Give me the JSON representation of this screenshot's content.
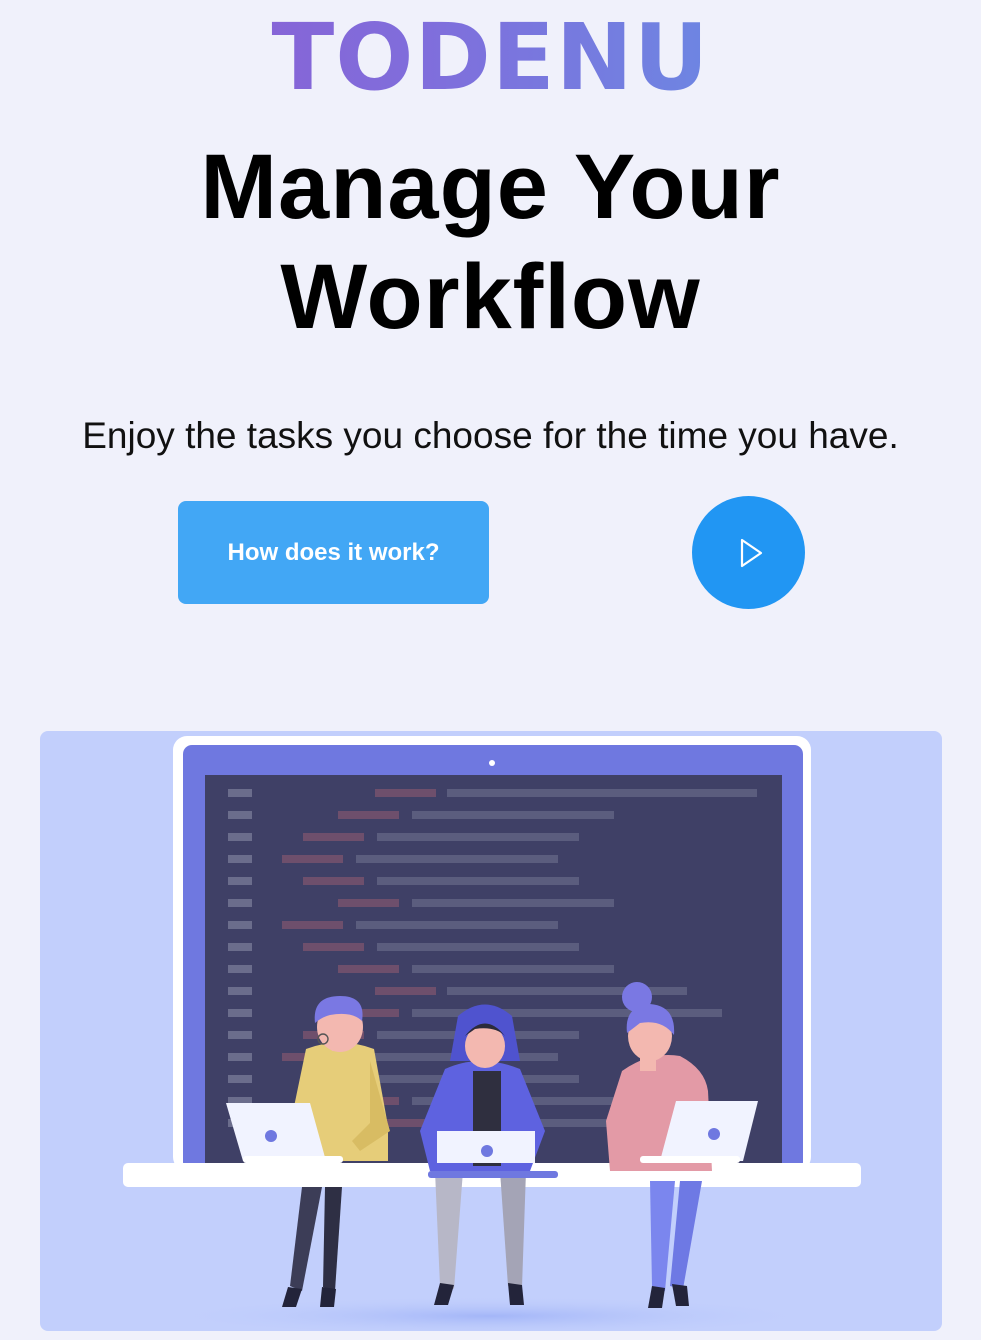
{
  "brand": {
    "logo_text": "TODENU"
  },
  "hero": {
    "headline_line1": "Manage Your",
    "headline_line2": "Workflow",
    "tagline": "Enjoy the tasks you choose for the time you have."
  },
  "actions": {
    "how_it_works_label": "How does it work?",
    "play_icon": "play-icon"
  },
  "illustration": {
    "subject": "three people with laptops sitting in front of a large screen showing code"
  },
  "colors": {
    "background": "#f0f1fb",
    "button_primary": "#42a7f5",
    "play_button": "#2196f3",
    "illustration_bg": "#c2cffc",
    "logo_gradient_start": "#9155cf",
    "logo_gradient_end": "#5c9ce8"
  }
}
